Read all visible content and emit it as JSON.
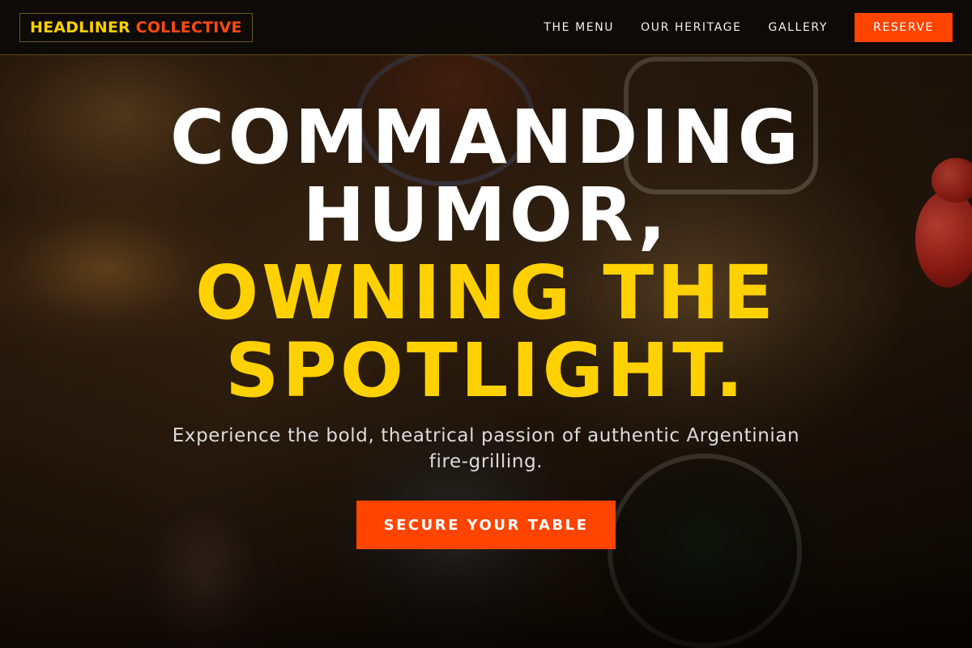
{
  "brand": {
    "name_part1": "HEADLINER",
    "name_part2": "COLLECTIVE",
    "color_primary": "#ffd000",
    "color_accent": "#ff4a12"
  },
  "nav": {
    "links": [
      {
        "label": "THE MENU"
      },
      {
        "label": "OUR HERITAGE"
      },
      {
        "label": "GALLERY"
      }
    ],
    "reserve_label": "RESERVE"
  },
  "hero": {
    "headline_line1": "COMMANDING",
    "headline_line2": "HUMOR,",
    "headline_line3": "OWNING THE",
    "headline_line4": "SPOTLIGHT.",
    "subtitle": "Experience the bold, theatrical passion of authentic Argentinian fire-grilling.",
    "cta_label": "SECURE YOUR TABLE",
    "headline_color_white": "#ffffff",
    "headline_color_yellow": "#ffd100",
    "cta_color": "#ff4400"
  }
}
